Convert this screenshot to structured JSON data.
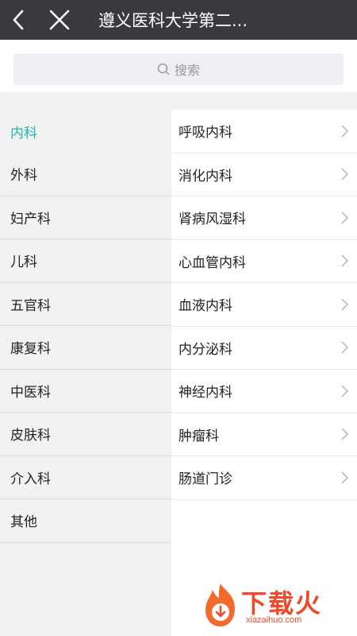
{
  "header": {
    "title": "遵义医科大学第二...",
    "back_icon": "chevron-left-icon",
    "close_icon": "close-icon"
  },
  "search": {
    "placeholder": "搜索",
    "icon": "search-icon"
  },
  "departments": {
    "categories": [
      {
        "label": "内科",
        "active": true
      },
      {
        "label": "外科"
      },
      {
        "label": "妇产科"
      },
      {
        "label": "儿科"
      },
      {
        "label": "五官科"
      },
      {
        "label": "康复科"
      },
      {
        "label": "中医科"
      },
      {
        "label": "皮肤科"
      },
      {
        "label": "介入科"
      },
      {
        "label": "其他"
      }
    ],
    "subdepartments": [
      {
        "label": "呼吸内科"
      },
      {
        "label": "消化内科"
      },
      {
        "label": "肾病风湿科"
      },
      {
        "label": "心血管内科"
      },
      {
        "label": "血液内科"
      },
      {
        "label": "内分泌科"
      },
      {
        "label": "神经内科"
      },
      {
        "label": "肿瘤科"
      },
      {
        "label": "肠道门诊"
      }
    ]
  },
  "watermark": {
    "brand": "下载火",
    "url": "xiazaihuo.com"
  },
  "colors": {
    "topbar": "#393a3f",
    "accent": "#1bb8ad",
    "watermark": "#f04a2b"
  }
}
